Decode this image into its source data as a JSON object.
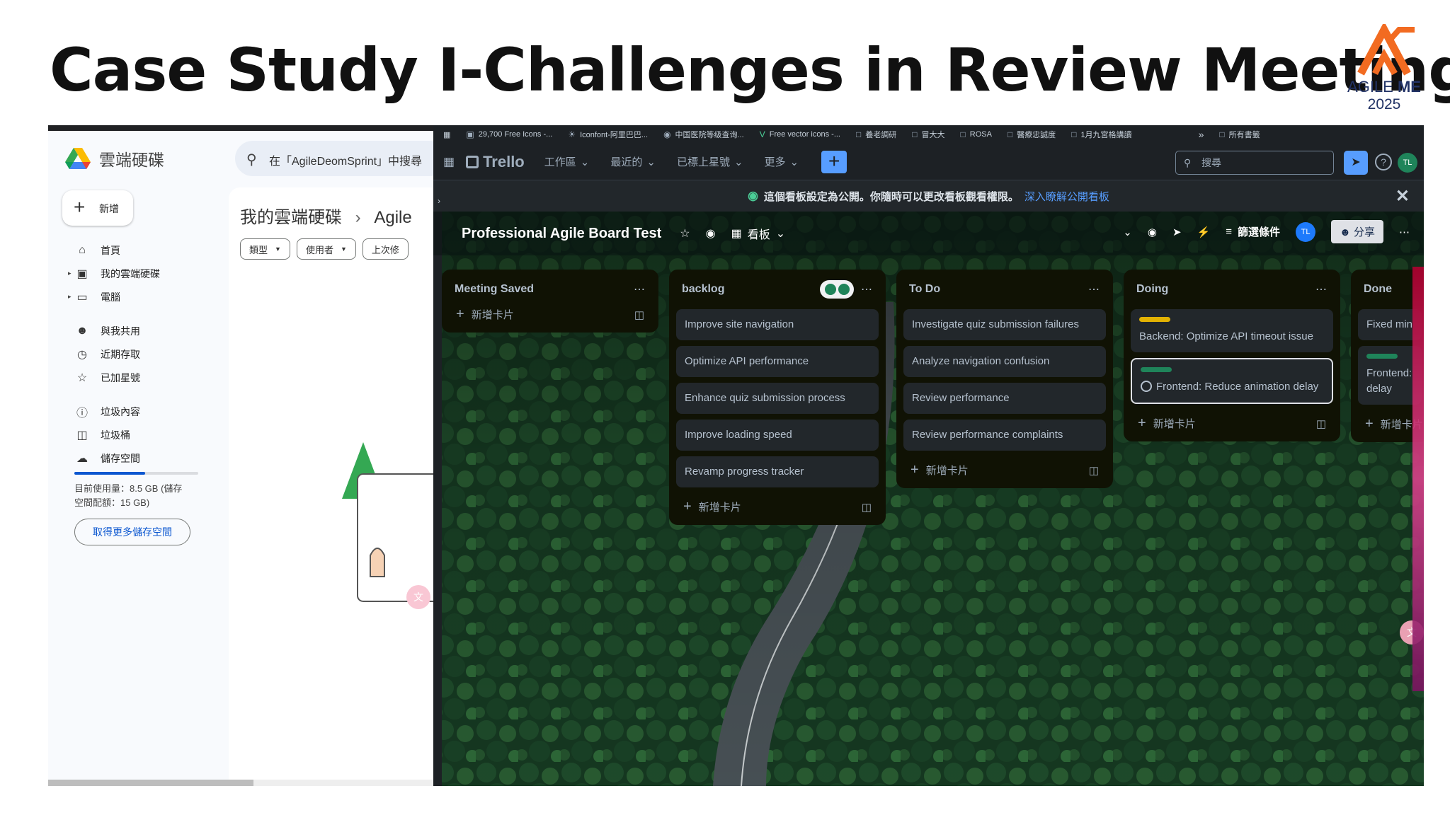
{
  "slide": {
    "title": "Case Study I-Challenges in Review Meeting",
    "logo": {
      "brand_a": "AGILE",
      "brand_b": "ME",
      "year": "2025",
      "color": "#f26b21"
    }
  },
  "gdrive": {
    "app_title": "雲端硬碟",
    "search_placeholder": "在「AgileDeomSprint」中搜尋",
    "new_label": "新增",
    "nav": [
      {
        "icon": "home-icon",
        "label": "首頁"
      },
      {
        "icon": "drive-icon",
        "label": "我的雲端硬碟"
      },
      {
        "icon": "computer-icon",
        "label": "電腦"
      },
      {
        "icon": "shared-icon",
        "label": "與我共用"
      },
      {
        "icon": "clock-icon",
        "label": "近期存取"
      },
      {
        "icon": "star-icon",
        "label": "已加星號"
      },
      {
        "icon": "spam-icon",
        "label": "垃圾內容"
      },
      {
        "icon": "trash-icon",
        "label": "垃圾桶"
      },
      {
        "icon": "cloud-icon",
        "label": "儲存空間"
      }
    ],
    "storage_fraction": 0.57,
    "usage_line1": "目前使用量：8.5 GB (儲存",
    "usage_line2": "空間配額：15 GB)",
    "get_more_label": "取得更多儲存空間",
    "breadcrumb_root": "我的雲端硬碟",
    "breadcrumb_sep": "›",
    "breadcrumb_current": "Agile",
    "filters": [
      "類型",
      "使用者",
      "上次修"
    ]
  },
  "trello": {
    "bookmarks": [
      "29,700 Free Icons -...",
      "Iconfont-阿里巴巴...",
      "中国医院等级查询...",
      "Free vector icons -...",
      "養老調研",
      "冒大大",
      "ROSA",
      "醫療忠誠度",
      "1月九宮格講讀",
      "所有書籤"
    ],
    "app_name": "Trello",
    "menu": [
      "工作區",
      "最近的",
      "已標上星號",
      "更多"
    ],
    "search_placeholder": "搜尋",
    "avatar_initials": "TL",
    "notice_text": "這個看板設定為公開。你隨時可以更改看板觀看權限。",
    "notice_link": "深入瞭解公開看板",
    "board_title": "Professional Agile Board Test",
    "view_label": "看板",
    "filter_label": "篩選條件",
    "share_label": "分享",
    "add_card_label": "新增卡片",
    "lists": [
      {
        "name": "Meeting Saved",
        "cards": []
      },
      {
        "name": "backlog",
        "cards": [
          {
            "text": "Improve site navigation"
          },
          {
            "text": "Optimize API performance"
          },
          {
            "text": "Enhance quiz submission process"
          },
          {
            "text": "Improve loading speed"
          },
          {
            "text": "Revamp progress tracker"
          }
        ]
      },
      {
        "name": "To Do",
        "cards": [
          {
            "text": "Investigate quiz submission failures"
          },
          {
            "text": "Analyze navigation confusion"
          },
          {
            "text": "Review performance"
          },
          {
            "text": "Review performance complaints"
          }
        ]
      },
      {
        "name": "Doing",
        "cards": [
          {
            "text": "Backend: Optimize API timeout issue",
            "label_color": "#e2b203"
          },
          {
            "text": "Frontend: Reduce animation delay",
            "label_color": "#1f845a",
            "selected": true
          }
        ]
      },
      {
        "name": "Done",
        "cards": [
          {
            "text": "Fixed min"
          },
          {
            "text": "Frontend: delay",
            "label_color": "#1f845a"
          }
        ]
      }
    ]
  }
}
